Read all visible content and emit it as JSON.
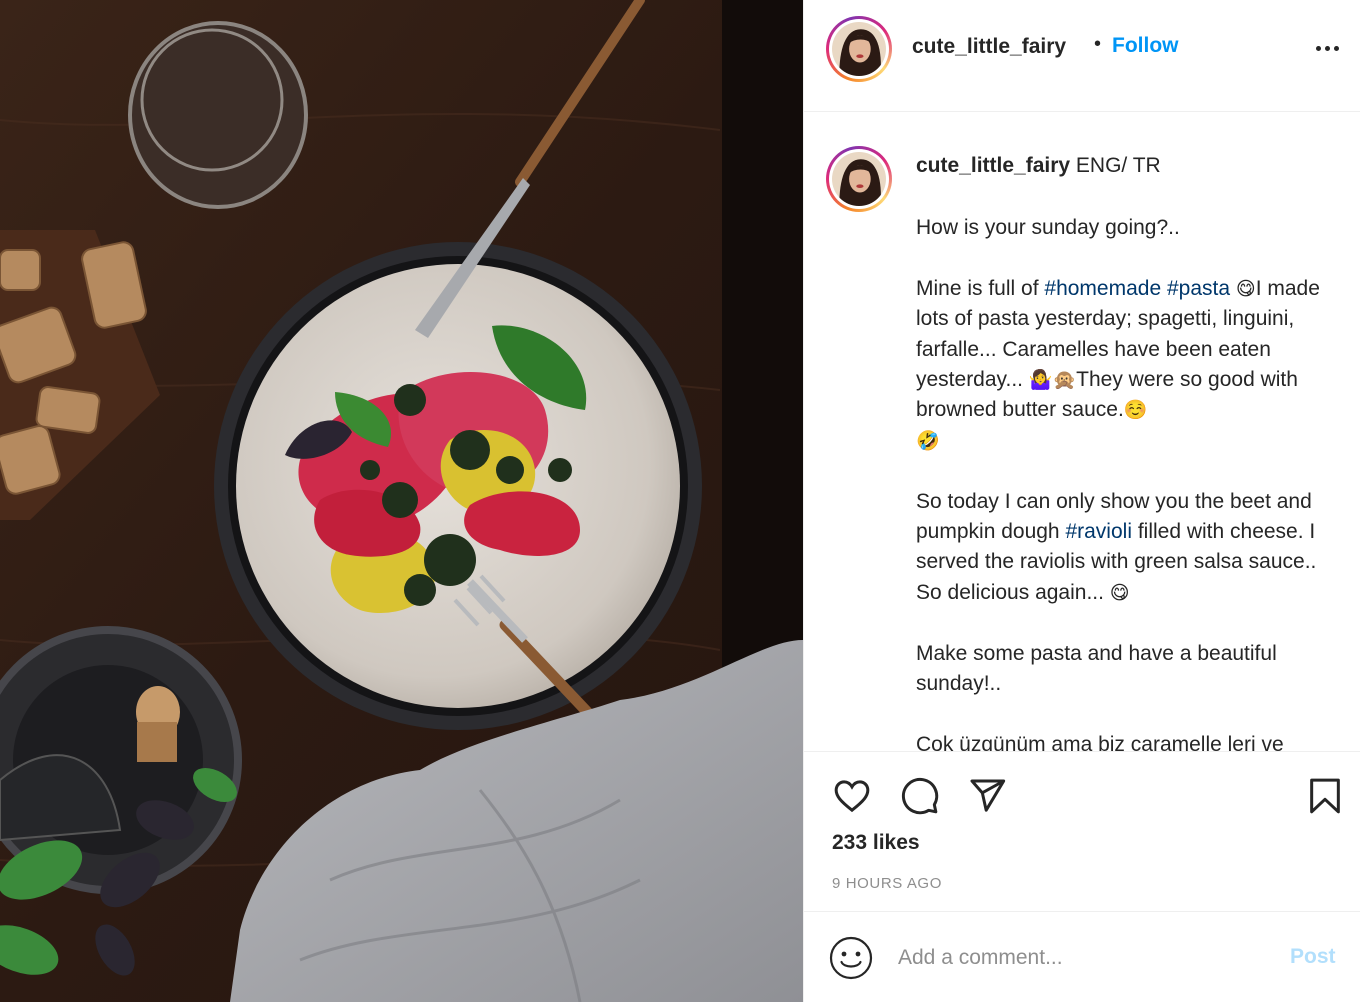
{
  "post": {
    "username": "cute_little_fairy",
    "follow_label": "Follow",
    "separator": "•",
    "image_alt": "Beet and pumpkin ravioli with basil on a white plate"
  },
  "caption": {
    "username": "cute_little_fairy",
    "lead": "ENG/ TR",
    "p1": "How is your sunday going?..",
    "p2_a": "Mine is full of ",
    "p2_tag1": "#homemade",
    "p2_tag2": "#pasta",
    "p2_emoji1": "😋",
    "p2_b": "I made lots of pasta yesterday; spagetti, linguini, farfalle... Caramelles have been eaten yesterday... ",
    "p2_emoji2": "🤷‍♀️🙊",
    "p2_c": "They were so good with browned butter sauce.",
    "p2_emoji3": "☺️",
    "p2_emoji4": "🤣",
    "p3_a": "So today I can only show you the beet and pumpkin dough ",
    "p3_tag": "#ravioli",
    "p3_b": " filled with cheese. I served the raviolis with green salsa sauce.. So delicious again... ",
    "p3_emoji": "😋",
    "p4": "Make some pasta and have a beautiful sunday!..",
    "p5": "Çok üzgünüm ama biz caramelle leri ve"
  },
  "actions": {
    "like_icon": "heart-icon",
    "comment_icon": "comment-bubble-icon",
    "share_icon": "paper-plane-icon",
    "save_icon": "bookmark-icon",
    "likes": "233 likes",
    "time": "9 HOURS AGO"
  },
  "comment_box": {
    "placeholder": "Add a comment...",
    "post_label": "Post"
  },
  "colors": {
    "link": "#0095f6",
    "hashtag": "#00376b",
    "muted": "#8e8e8e",
    "post_disabled": "#b2dffc"
  }
}
